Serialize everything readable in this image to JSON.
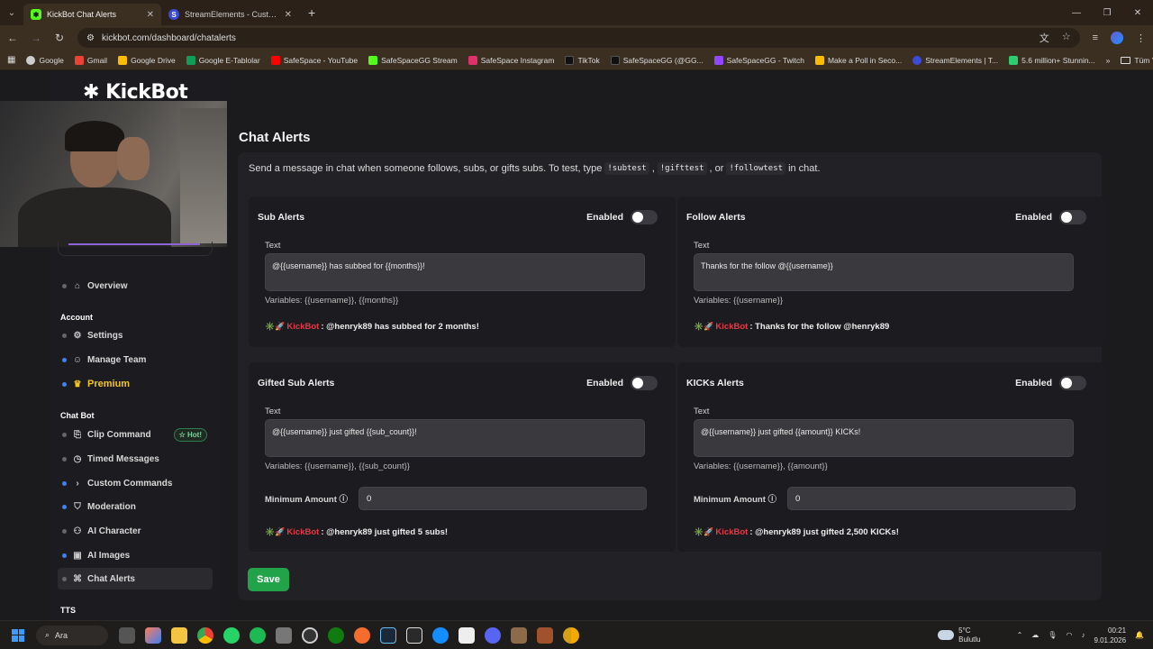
{
  "browser": {
    "tabs": [
      {
        "title": "KickBot Chat Alerts",
        "active": true,
        "favicon_color": "#53fc18"
      },
      {
        "title": "StreamElements - Custom comm",
        "active": false,
        "favicon_color": "#3b4bd9"
      }
    ],
    "url": "kickbot.com/dashboard/chatalerts",
    "bookmarks": [
      {
        "label": "Google",
        "color": "#cccccc"
      },
      {
        "label": "Gmail",
        "color": "#ea4335"
      },
      {
        "label": "Google Drive",
        "color": "#fbbc04"
      },
      {
        "label": "Google E-Tablolar",
        "color": "#0f9d58"
      },
      {
        "label": "SafeSpace - YouTube",
        "color": "#ff0000"
      },
      {
        "label": "SafeSpaceGG Stream",
        "color": "#53fc18"
      },
      {
        "label": "SafeSpace Instagram",
        "color": "#e1306c"
      },
      {
        "label": "TikTok",
        "color": "#000000"
      },
      {
        "label": "SafeSpaceGG (@GG...",
        "color": "#000000"
      },
      {
        "label": "SafeSpaceGG - Twitch",
        "color": "#9146ff"
      },
      {
        "label": "Make a Poll in Seco...",
        "color": "#fbbc04"
      },
      {
        "label": "StreamElements | T...",
        "color": "#3b4bd9"
      },
      {
        "label": "5.6 million+ Stunnin...",
        "color": "#2ecc71"
      }
    ],
    "bookmarks_folder": "Tüm Yer İşaretleri",
    "bookmarks_more": "»"
  },
  "app": {
    "logo": "✱ KickBot"
  },
  "sidebar": {
    "overview": "Overview",
    "account_label": "Account",
    "settings": "Settings",
    "manage_team": "Manage Team",
    "premium": "Premium",
    "chatbot_label": "Chat Bot",
    "clip_command": "Clip Command",
    "hot_badge": "☆ Hot!",
    "timed_messages": "Timed Messages",
    "custom_commands": "Custom Commands",
    "moderation": "Moderation",
    "ai_character": "AI Character",
    "ai_images": "AI Images",
    "chat_alerts": "Chat Alerts",
    "tts_label": "TTS"
  },
  "main": {
    "title": "Chat Alerts",
    "desc_prefix": "Send a message in chat when someone follows, subs, or gifts subs. To test, type",
    "cmd_sub": "!subtest",
    "comma1": ",",
    "cmd_gift": "!gifttest",
    "or": ", or",
    "cmd_follow": "!followtest",
    "desc_suffix": "in chat.",
    "enabled_label": "Enabled",
    "text_label": "Text",
    "min_amount_label": "Minimum Amount ⓘ",
    "bot_name": "KickBot",
    "save": "Save",
    "cards": {
      "sub": {
        "title": "Sub Alerts",
        "text": "@{{username}} has subbed for {{months}}!",
        "vars": "Variables: {{username}}, {{months}}",
        "preview": ": @henryk89 has subbed for 2 months!"
      },
      "follow": {
        "title": "Follow Alerts",
        "text": "Thanks for the follow @{{username}}",
        "vars": "Variables: {{username}}",
        "preview": ": Thanks for the follow @henryk89"
      },
      "gifted": {
        "title": "Gifted Sub Alerts",
        "text": "@{{username}} just gifted {{sub_count}}!",
        "vars": "Variables: {{username}}, {{sub_count}}",
        "min_value": "0",
        "preview": ": @henryk89 just gifted 5 subs!"
      },
      "kicks": {
        "title": "KICKs Alerts",
        "text": "@{{username}} just gifted {{amount}} KICKs!",
        "vars": "Variables: {{username}}, {{amount}}",
        "min_value": "0",
        "preview": ": @henryk89 just gifted 2,500 KICKs!"
      }
    }
  },
  "taskbar": {
    "search": "Ara",
    "weather_temp": "5°C",
    "weather_desc": "Bulutlu",
    "time": "00:21",
    "date": "9.01.2026"
  },
  "colors": {
    "accent_green": "#22a34a",
    "kickbot_red": "#e53946",
    "premium_gold": "#f5c518"
  }
}
